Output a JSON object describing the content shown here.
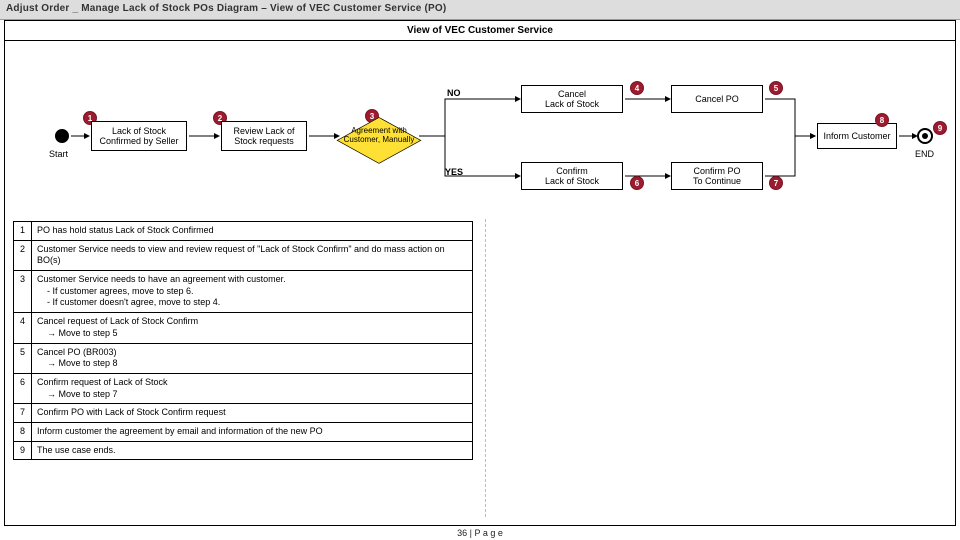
{
  "header": {
    "title": "Adjust Order _ Manage Lack of Stock POs Diagram – View of VEC Customer Service (PO)"
  },
  "pool": {
    "title": "View of VEC Customer Service"
  },
  "nodes": {
    "start": "Start",
    "n1": "Lack of Stock\nConfirmed by Seller",
    "n2": "Review Lack of\nStock requests",
    "n3": "Agreement with\nCustomer, Manually",
    "n4_cancel_los": "Cancel\nLack of Stock",
    "n5_cancel_po": "Cancel PO",
    "n6_confirm_los": "Confirm\nLack of Stock",
    "n7_confirm_po": "Confirm PO\nTo Continue",
    "n8_inform": "Inform Customer",
    "branch_no": "NO",
    "branch_yes": "YES",
    "end": "END"
  },
  "badges": {
    "1": "1",
    "2": "2",
    "3": "3",
    "4": "4",
    "5": "5",
    "6": "6",
    "7": "7",
    "8": "8",
    "9": "9"
  },
  "steps": {
    "1": "PO has hold status Lack of Stock Confirmed",
    "2": "Customer Service needs to view and review request of \"Lack of Stock Confirm\" and do mass action on BO(s)",
    "3": "Customer Service needs to have an agreement with customer.",
    "3a": "- If customer agrees, move to step 6.",
    "3b": "- If customer doesn't agree, move to step 4.",
    "4": "Cancel request of Lack of Stock Confirm",
    "4a": "→ Move to step 5",
    "5": "Cancel PO (BR003)",
    "5a": "→ Move to step 8",
    "6": "Confirm request of Lack of Stock",
    "6a": "→ Move to step 7",
    "7": "Confirm PO with Lack of Stock Confirm request",
    "8": "Inform customer the agreement by email and information of the new PO",
    "9": "The use case ends."
  },
  "footer": {
    "page_label": "36 | P a g e"
  }
}
